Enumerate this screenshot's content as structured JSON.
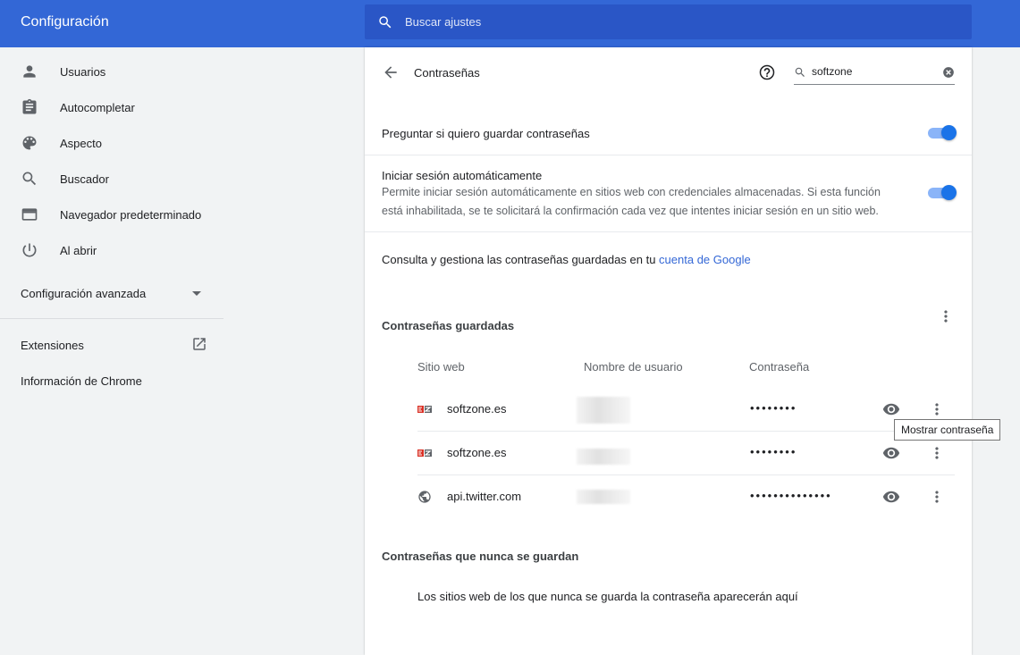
{
  "header": {
    "title": "Configuración",
    "search_placeholder": "Buscar ajustes"
  },
  "sidebar": {
    "items": [
      {
        "label": "Usuarios",
        "icon": "person-icon"
      },
      {
        "label": "Autocompletar",
        "icon": "clipboard-icon"
      },
      {
        "label": "Aspecto",
        "icon": "palette-icon"
      },
      {
        "label": "Buscador",
        "icon": "search-icon"
      },
      {
        "label": "Navegador predeterminado",
        "icon": "browser-icon"
      },
      {
        "label": "Al abrir",
        "icon": "power-icon"
      }
    ],
    "advanced_label": "Configuración avanzada",
    "extensions_label": "Extensiones",
    "about_label": "Información de Chrome"
  },
  "passwords": {
    "page_title": "Contraseñas",
    "filter_value": "softzone",
    "offer_to_save": {
      "label": "Preguntar si quiero guardar contraseñas",
      "enabled": true
    },
    "auto_signin": {
      "label": "Iniciar sesión automáticamente",
      "description_line1": "Permite iniciar sesión automáticamente en sitios web con credenciales almacenadas. Si esta función",
      "description_line2": "está inhabilitada, se te solicitará la confirmación cada vez que intentes iniciar sesión en un sitio web.",
      "enabled": true
    },
    "manage_text": "Consulta y gestiona las contraseñas guardadas en tu ",
    "manage_link": "cuenta de Google",
    "saved_title": "Contraseñas guardadas",
    "columns": {
      "site": "Sitio web",
      "username": "Nombre de usuario",
      "password": "Contraseña"
    },
    "rows": [
      {
        "site": "softzone.es",
        "favicon": "softzone-favicon",
        "password": "••••••••"
      },
      {
        "site": "softzone.es",
        "favicon": "softzone-favicon",
        "password": "••••••••"
      },
      {
        "site": "api.twitter.com",
        "favicon": "globe-icon",
        "password": "••••••••••••••"
      }
    ],
    "tooltip": "Mostrar contraseña",
    "never_saved_title": "Contraseñas que nunca se guardan",
    "never_saved_empty": "Los sitios web de los que nunca se guarda la contraseña aparecerán aquí"
  },
  "colors": {
    "header": "#3367d6",
    "search": "#2a56c6",
    "accent": "#1a73e8",
    "link": "#3367d6"
  }
}
